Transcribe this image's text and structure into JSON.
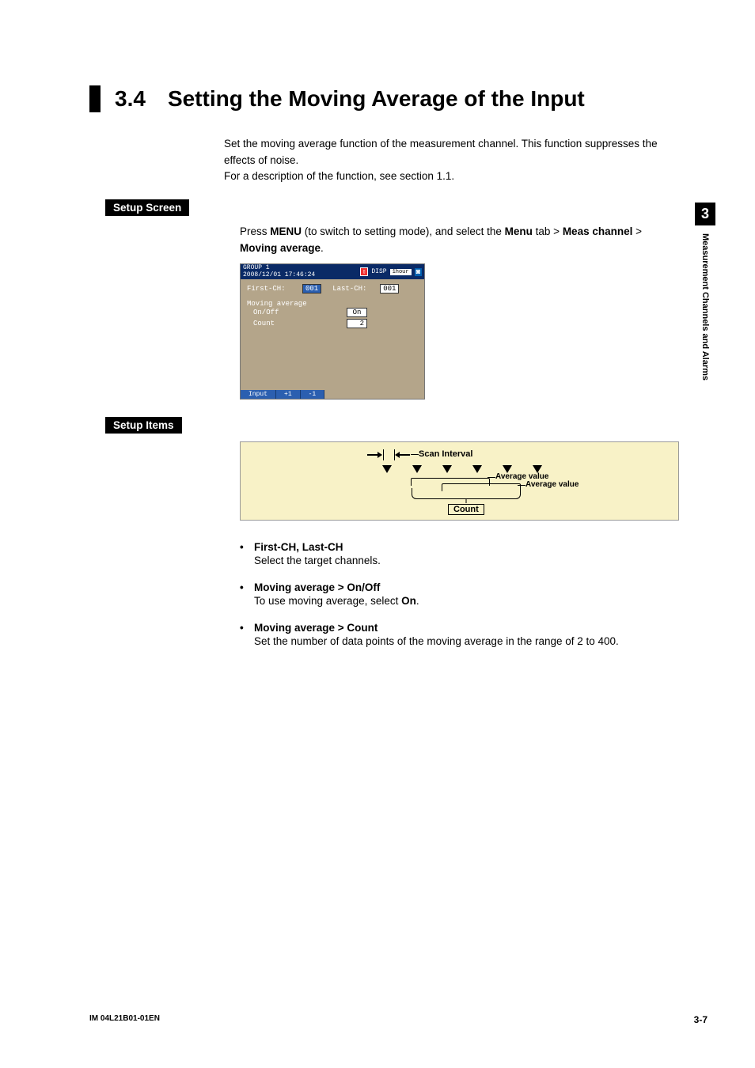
{
  "heading": {
    "number": "3.4",
    "title": "Setting the Moving Average of the Input"
  },
  "intro": {
    "line1": "Set the moving average function of the measurement channel. This function suppresses the effects of noise.",
    "line2": "For a description of the function, see section 1.1."
  },
  "setup_screen": {
    "label": "Setup Screen",
    "instr_pre": "Press ",
    "instr_menu": "MENU",
    "instr_mid1": " (to switch to setting mode), and select the ",
    "instr_menu2": "Menu",
    "instr_mid2": " tab > ",
    "instr_meas": "Meas channel",
    "instr_mid3": " > ",
    "instr_last": "Moving average",
    "instr_period": "."
  },
  "screenshot": {
    "group": "GROUP 1",
    "datetime": "2008/12/01 17:46:24",
    "disp": "DISP",
    "duration": "1hour",
    "first_ch_label": "First-CH:",
    "first_ch_val": "001",
    "last_ch_label": "Last-CH:",
    "last_ch_val": "001",
    "ma_label": "Moving average",
    "onoff_label": "On/Off",
    "onoff_val": "On",
    "count_label": "Count",
    "count_val": "2",
    "btn_input": "Input",
    "btn_plus": "+1",
    "btn_minus": "-1"
  },
  "setup_items": {
    "label": "Setup Items"
  },
  "diagram": {
    "scan_interval": "Scan Interval",
    "avg1": "Average value",
    "avg2": "Average value",
    "count": "Count"
  },
  "items": [
    {
      "title": "First-CH, Last-CH",
      "desc": "Select the target channels."
    },
    {
      "title": "Moving average > On/Off",
      "desc_pre": "To use moving average, select ",
      "desc_bold": "On",
      "desc_post": "."
    },
    {
      "title": "Moving average > Count",
      "desc": "Set the number of data points of the moving average in the range of 2 to 400."
    }
  ],
  "side": {
    "number": "3",
    "text": "Measurement Channels and Alarms"
  },
  "footer": {
    "left": "IM 04L21B01-01EN",
    "right": "3-7"
  }
}
